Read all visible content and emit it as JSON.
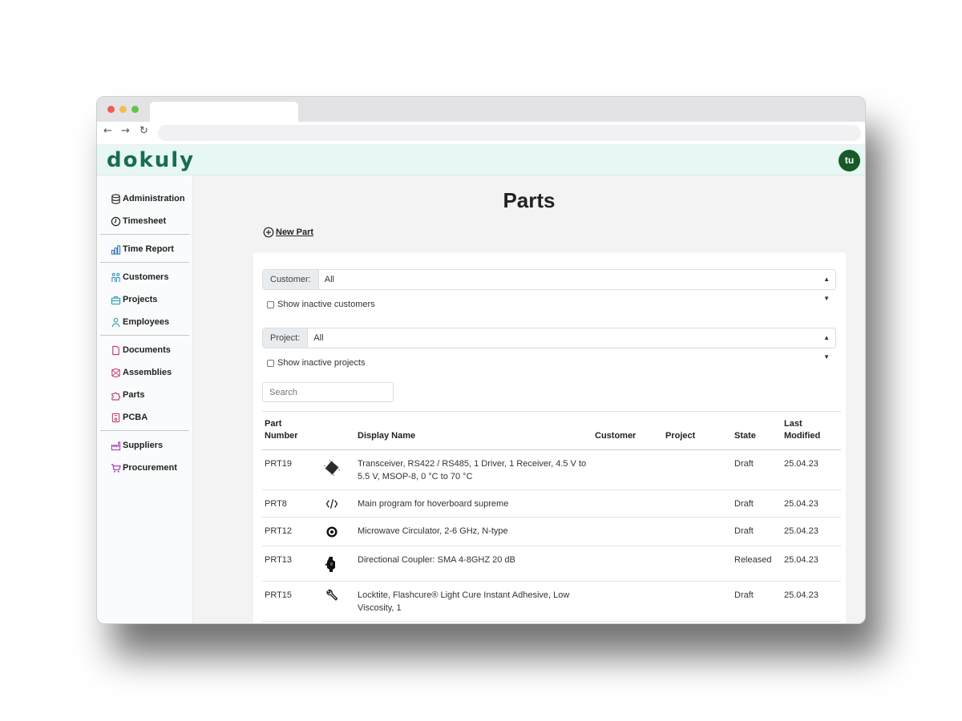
{
  "app": {
    "logo": "dokuly",
    "avatar_initials": "tu",
    "accent_color": "#1b6b55",
    "header_bg": "#e6f7f4"
  },
  "browser": {
    "back_icon": "arrow-left-icon",
    "forward_icon": "arrow-right-icon",
    "reload_icon": "reload-icon"
  },
  "sidebar": {
    "items": [
      {
        "label": "Administration",
        "icon": "database-icon"
      },
      {
        "label": "Timesheet",
        "icon": "clock-icon"
      },
      {
        "label": "Time Report",
        "icon": "bar-chart-icon"
      },
      {
        "label": "Customers",
        "icon": "people-icon"
      },
      {
        "label": "Projects",
        "icon": "briefcase-icon"
      },
      {
        "label": "Employees",
        "icon": "person-icon"
      },
      {
        "label": "Documents",
        "icon": "document-icon"
      },
      {
        "label": "Assemblies",
        "icon": "assembly-icon"
      },
      {
        "label": "Parts",
        "icon": "puzzle-icon"
      },
      {
        "label": "PCBA",
        "icon": "pcb-icon"
      },
      {
        "label": "Suppliers",
        "icon": "factory-icon"
      },
      {
        "label": "Procurement",
        "icon": "cart-icon"
      }
    ]
  },
  "main": {
    "title": "Parts",
    "new_part_label": "New Part",
    "customer_filter": {
      "label": "Customer:",
      "value": "All"
    },
    "show_inactive_customers": "Show inactive customers",
    "project_filter": {
      "label": "Project:",
      "value": "All"
    },
    "show_inactive_projects": "Show inactive projects",
    "search_placeholder": "Search"
  },
  "table": {
    "headers": {
      "part_number_1": "Part",
      "part_number_2": "Number",
      "display_name": "Display Name",
      "customer": "Customer",
      "project": "Project",
      "state": "State",
      "last_modified_1": "Last",
      "last_modified_2": "Modified"
    },
    "rows": [
      {
        "part_number": "PRT19",
        "thumb": "chip-icon",
        "display_name": "Transceiver, RS422 / RS485, 1 Driver, 1 Receiver, 4.5 V to 5.5 V, MSOP-8, 0 °C to 70 °C",
        "customer": "",
        "project": "",
        "state": "Draft",
        "last_modified": "25.04.23"
      },
      {
        "part_number": "PRT8",
        "thumb": "code-icon",
        "display_name": "Main program for hoverboard supreme",
        "customer": "",
        "project": "",
        "state": "Draft",
        "last_modified": "25.04.23"
      },
      {
        "part_number": "PRT12",
        "thumb": "circulator-icon",
        "display_name": "Microwave Circulator, 2-6 GHz, N-type",
        "customer": "",
        "project": "",
        "state": "Draft",
        "last_modified": "25.04.23"
      },
      {
        "part_number": "PRT13",
        "thumb": "coupler-icon",
        "display_name": "Directional Coupler: SMA 4-8GHZ 20 dB",
        "customer": "",
        "project": "",
        "state": "Released",
        "last_modified": "25.04.23"
      },
      {
        "part_number": "PRT15",
        "thumb": "wrench-icon",
        "display_name": "Locktite, Flashcure® Light Cure Instant Adhesive, Low Viscosity, 1",
        "customer": "",
        "project": "",
        "state": "Draft",
        "last_modified": "25.04.23"
      }
    ]
  }
}
